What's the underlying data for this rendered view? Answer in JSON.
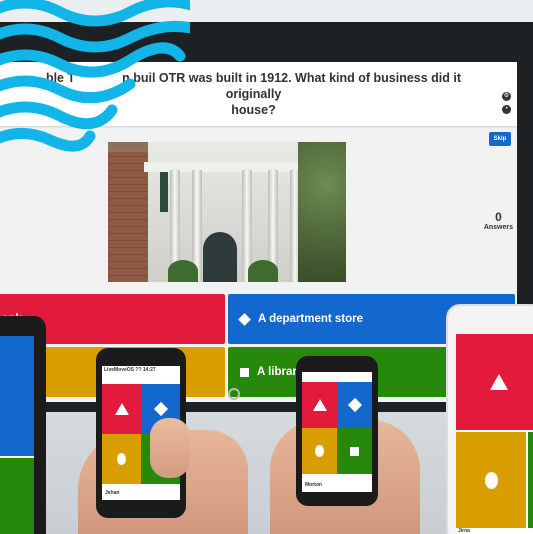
{
  "question": {
    "text": "The building that OTR was built in 1912. What kind of business did it originally house?",
    "visible_prefix": "ble T",
    "visible_mid": "n buil",
    "visible_rest": " OTR was built in 1912. What kind of business did it originally",
    "visible_line2": "house?"
  },
  "skip_label": "Skip",
  "answers_counter": {
    "value": "0",
    "label": "Answers"
  },
  "answers": [
    {
      "label": "ank",
      "color": "#e21b3c",
      "shape": "triangle"
    },
    {
      "label": "A department store",
      "color": "#1368ce",
      "shape": "diamond"
    },
    {
      "label": "",
      "color": "#d89e00",
      "shape": "circle"
    },
    {
      "label": "A library",
      "color": "#26890c",
      "shape": "square"
    }
  ],
  "phones": [
    {
      "status": "LiveMoveOS  ??    14:27",
      "player": "Jehan"
    },
    {
      "player": "Morton"
    },
    {
      "player": "Jirna"
    }
  ],
  "colors": {
    "red": "#e21b3c",
    "blue": "#1368ce",
    "yellow": "#d89e00",
    "green": "#26890c"
  }
}
